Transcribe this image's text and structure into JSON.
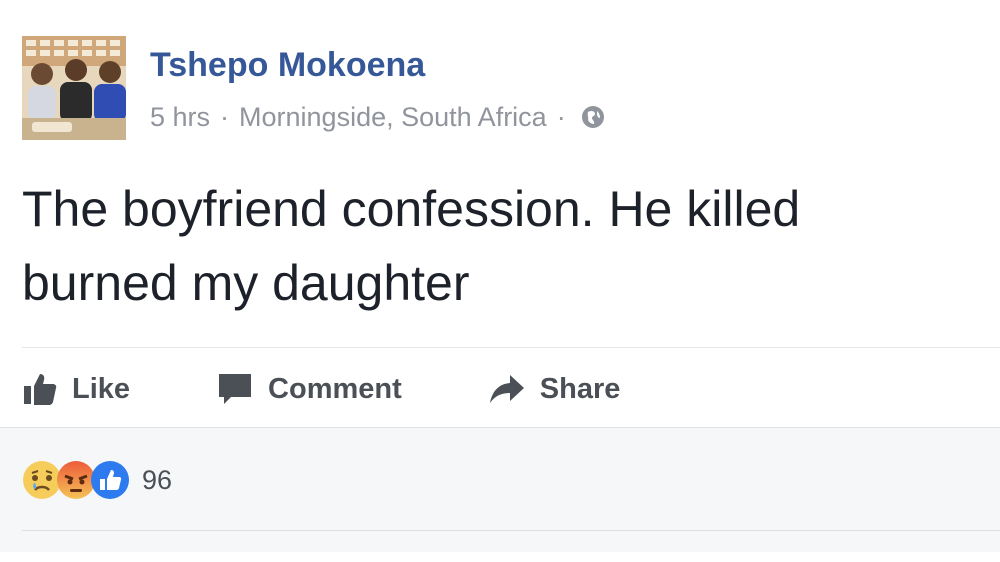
{
  "post": {
    "author": "Tshepo Mokoena",
    "time": "5 hrs",
    "location": "Morningside, South Africa",
    "separator": "·",
    "privacy_icon": "globe-icon",
    "text_line1": "The boyfriend confession. He killed",
    "text_line2": "burned my daughter"
  },
  "actions": {
    "like_label": "Like",
    "comment_label": "Comment",
    "share_label": "Share"
  },
  "reactions": {
    "types": [
      "sad-icon",
      "angry-icon",
      "like-reaction-icon"
    ],
    "count": "96"
  },
  "colors": {
    "author_link": "#365899",
    "meta_gray": "#90949c",
    "action_gray": "#4b4f56",
    "like_blue": "#2e7bf0",
    "angry_red": "#ec5b3a",
    "sad_yellow": "#f6cd5b"
  }
}
